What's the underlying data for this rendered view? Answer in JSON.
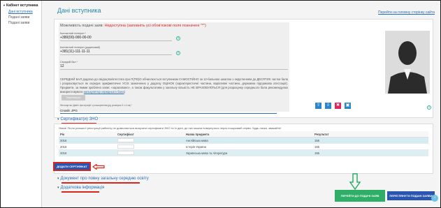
{
  "sidebar": {
    "title": "Кабінет вступника",
    "items": [
      {
        "label": "Дані вступника"
      },
      {
        "label": "Подані заяви"
      },
      {
        "label": "Подані заяви"
      }
    ]
  },
  "header": {
    "title": "Дані вступника",
    "home_link": "Перейти на головну сторінку сайта"
  },
  "form": {
    "warning_prefix": "Можливість подачі заяв:",
    "warning_status": "Недоступна (заповніть усі обов'язкові поля позначені \"*\")",
    "contact_phone_label": "Контактний телефон *",
    "contact_phone_value": "+380(00)-000-00-00",
    "extra_phone_label": "Контактний телефон (додатковий)",
    "extra_phone_value": "+381(11)-111-11-11",
    "avg_score_label": "Середній бал *",
    "avg_score_value": "12",
    "paragraph_main": "СЕРЕДНІЙ БАЛ додатка до свідоцтва/атестата про П(ПО)О обчислюється вступником САМОСТІЙНО за 12-бальною шкалою з округленням до ДЕСЯТИХ частки бала і розраховується як середнє арифметичне УСІХ зазначених у додатку ОЦІНОК (характеристичні частини, варіативні частини, державна підсумкова атестація). Предмети, за якими зроблено запис «зараховано», а також факультативи у загальну кількість НЕ ВРАХОВУЮТЬСЯ (для розрахунку середнього бала рекомендуємо використовувати",
    "paragraph_link": "калькулятор середнього бала",
    "disabled_button": "Переглянути",
    "photo_note": "Фотокартка (файл фотографії з розширенням jpg розміром 3 x 4 см) *",
    "file_value": "Спокій .JPG"
  },
  "zno": {
    "section_title": "Сертифікат(и) ЗНО",
    "note": "Увага! Після успішної реєстрації кабінету не дозволяється вилучати сертифікати ЗНО та їх дані, до них можна повернутися через пошуковий сервіс. Будь ласка, зважайте!",
    "columns": [
      "Рік",
      "Сертифікат",
      "Назва предмета",
      "Результат"
    ],
    "rows": [
      {
        "year": "2016",
        "subject": "Англійська мова",
        "result": "155"
      },
      {
        "year": "2016",
        "subject": "Історія України",
        "result": "155"
      },
      {
        "year": "2016",
        "subject": "Українська мова та література",
        "result": "155"
      }
    ],
    "add_button": "ДОДАТИ СЕРТИФІКАТ"
  },
  "sections": {
    "secondary_doc": "Документ про повну загальну середню освіту",
    "additional_info": "Додаткова інформація"
  },
  "actions": {
    "next_button": "ПЕРЕЙТИ ДО ПОДАЧІ ЗАЯВ",
    "review_button": "ПЕРЕГЛЯНУТИ ПОДАНІ ЗАЯВИ"
  },
  "colors": {
    "accent_blue": "#2a56b0",
    "teal_title": "#2a8aa8",
    "warning_red": "#d9261c",
    "action_green": "#2fae68"
  }
}
